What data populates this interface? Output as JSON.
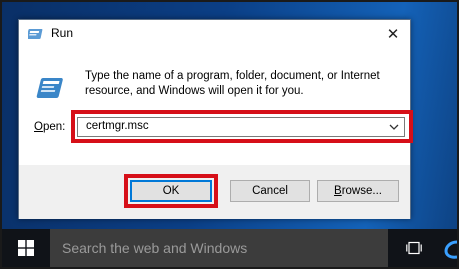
{
  "dialog": {
    "title": "Run",
    "close_glyph": "✕",
    "description": "Type the name of a program, folder, document, or Internet resource, and Windows will open it for you.",
    "open_label_access": "O",
    "open_label_rest": "pen:",
    "open_value": "certmgr.msc",
    "ok_label": "OK",
    "cancel_label": "Cancel",
    "browse_label_access": "B",
    "browse_label_rest": "rowse..."
  },
  "taskbar": {
    "search_placeholder": "Search the web and Windows"
  },
  "icons": {
    "title": "run-icon",
    "big": "run-icon",
    "start": "windows-logo-icon",
    "taskview": "task-view-icon",
    "dropdown": "chevron-down-icon"
  },
  "colors": {
    "highlight": "#d60f18",
    "focus_border": "#0078d7",
    "taskbar": "#101318",
    "search_box": "#3c3c3c"
  }
}
